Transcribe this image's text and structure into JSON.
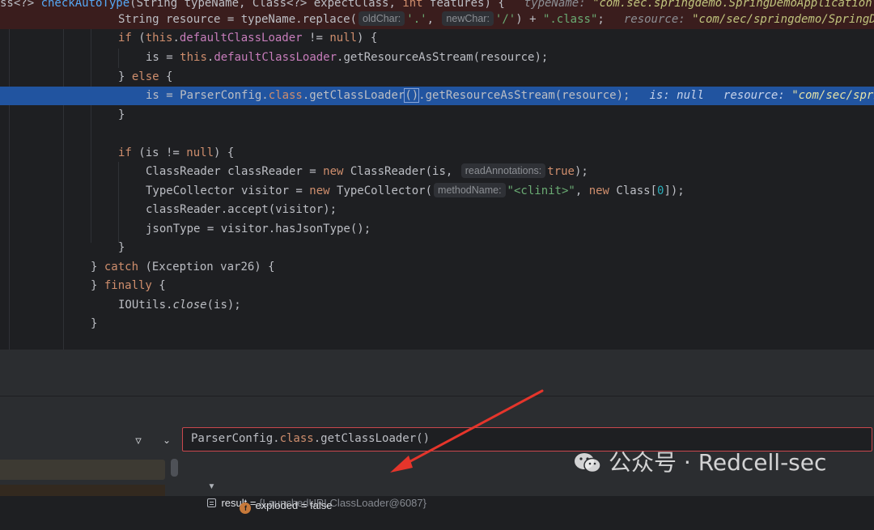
{
  "editor": {
    "line1": {
      "pre": "ss<?> ",
      "method": "checkAutoType",
      "params": "(String typeName, Class<?> expectClass, ",
      "kw_int": "int",
      "tail": " features) {",
      "dbg_name": "typeName: ",
      "dbg_val": "\"com.sec.springdemo.SpringDemoApplication\""
    },
    "line2": {
      "code_a": "String resource = typeName.replace(",
      "hint1": "oldChar:",
      "str1": "'.'",
      "comma": ", ",
      "hint2": "newChar:",
      "str2": "'/'",
      "code_b": ") + ",
      "str3": "\".class\"",
      "semi": ";",
      "dbg_name": "resource: ",
      "dbg_val": "\"com/sec/springdemo/SpringD"
    },
    "line3": {
      "kw_if": "if",
      "open": " (",
      "kw_this": "this",
      "dot": ".",
      "field": "defaultClassLoader",
      "rest": " != ",
      "kw_null": "null",
      "close": ") {"
    },
    "line4": {
      "pre": "is = ",
      "kw_this": "this",
      "dot": ".",
      "field": "defaultClassLoader",
      "rest": ".getResourceAsStream(resource);"
    },
    "line5": {
      "brace": "} ",
      "kw_else": "else",
      "open": " {"
    },
    "line6": {
      "pre": "is = ParserConfig.",
      "kw_class": "class",
      "mid": ".getClassLoader",
      "parens": "()",
      "rest": ".getResourceAsStream(resource);",
      "dbg1": "is: null",
      "dbg2_name": "resource: ",
      "dbg2_val": "\"com/sec/spri"
    },
    "line7": {
      "text": "}"
    },
    "line9": {
      "kw_if": "if",
      "open": " (is != ",
      "kw_null": "null",
      "close": ") {"
    },
    "line10": {
      "pre": "ClassReader classReader = ",
      "kw_new": "new",
      "mid": " ClassReader(is, ",
      "hint": "readAnnotations:",
      "kw_true": "true",
      "close": ");"
    },
    "line11": {
      "pre": "TypeCollector visitor = ",
      "kw_new": "new",
      "mid": " TypeCollector(",
      "hint": "methodName:",
      "str": "\"<clinit>\"",
      "comma": ", ",
      "kw_new2": "new",
      "cls": " Class[",
      "num": "0",
      "close": "]);"
    },
    "line12": {
      "text": "classReader.accept(visitor);"
    },
    "line13": {
      "text": "jsonType = visitor.hasJsonType();"
    },
    "line14": {
      "text": "}"
    },
    "line15": {
      "brace": "} ",
      "kw_catch": "catch",
      "rest": " (Exception var26) {"
    },
    "line16": {
      "brace": "} ",
      "kw_finally": "finally",
      "rest": " {"
    },
    "line17": {
      "cls": "IOUtils.",
      "method": "close",
      "rest": "(is);"
    },
    "line18": {
      "text": "}"
    }
  },
  "debugger": {
    "filter_icon": "filter-icon",
    "dropdown_icon": "chevron-down-icon",
    "expression": {
      "pre": "ParserConfig.",
      "kw_class": "class",
      "rest": ".getClassLoader()"
    },
    "result": {
      "name": "result",
      "eq": " = ",
      "value": "{LaunchedURLClassLoader@6087}"
    },
    "field": {
      "name": "exploded",
      "eq": " = ",
      "value": "false"
    }
  },
  "watermark": {
    "text": "公众号 · Redcell-sec"
  },
  "colors": {
    "editor_bg": "#1e1f22",
    "exec_line": "#2154a0",
    "breakpoint_line": "#3a1d1d",
    "keyword": "#cf8e6d",
    "field": "#c77dbb",
    "string": "#6aab73",
    "number": "#2aacb8",
    "annotation_arrow": "#e5352b",
    "expr_border": "#c9474d"
  }
}
